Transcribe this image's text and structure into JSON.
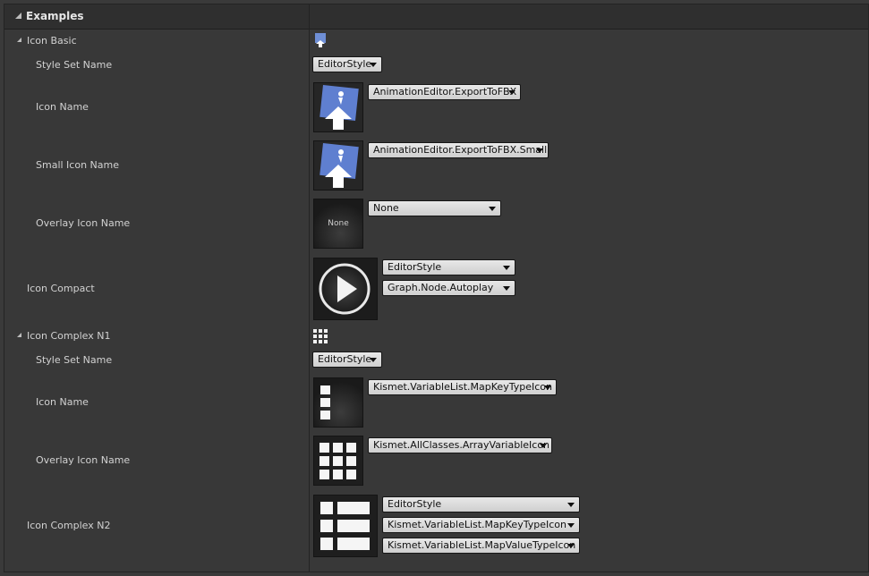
{
  "section": {
    "title": "Examples"
  },
  "icon_basic": {
    "label": "Icon Basic",
    "style_set_label": "Style Set Name",
    "style_set_value": "EditorStyle",
    "icon_name_label": "Icon Name",
    "icon_name_value": "AnimationEditor.ExportToFBX",
    "small_icon_label": "Small Icon Name",
    "small_icon_value": "AnimationEditor.ExportToFBX.Small",
    "overlay_label": "Overlay Icon Name",
    "overlay_value": "None",
    "overlay_preview_text": "None"
  },
  "icon_compact": {
    "label": "Icon Compact",
    "style_value": "EditorStyle",
    "icon_value": "Graph.Node.Autoplay"
  },
  "icon_complex_n1": {
    "label": "Icon Complex N1",
    "style_set_label": "Style Set Name",
    "style_set_value": "EditorStyle",
    "icon_name_label": "Icon Name",
    "icon_name_value": "Kismet.VariableList.MapKeyTypeIcon",
    "overlay_label": "Overlay Icon Name",
    "overlay_value": "Kismet.AllClasses.ArrayVariableIcon"
  },
  "icon_complex_n2": {
    "label": "Icon Complex N2",
    "style_value": "EditorStyle",
    "key_value": "Kismet.VariableList.MapKeyTypeIcon",
    "value_value": "Kismet.VariableList.MapValueTypeIcon"
  }
}
